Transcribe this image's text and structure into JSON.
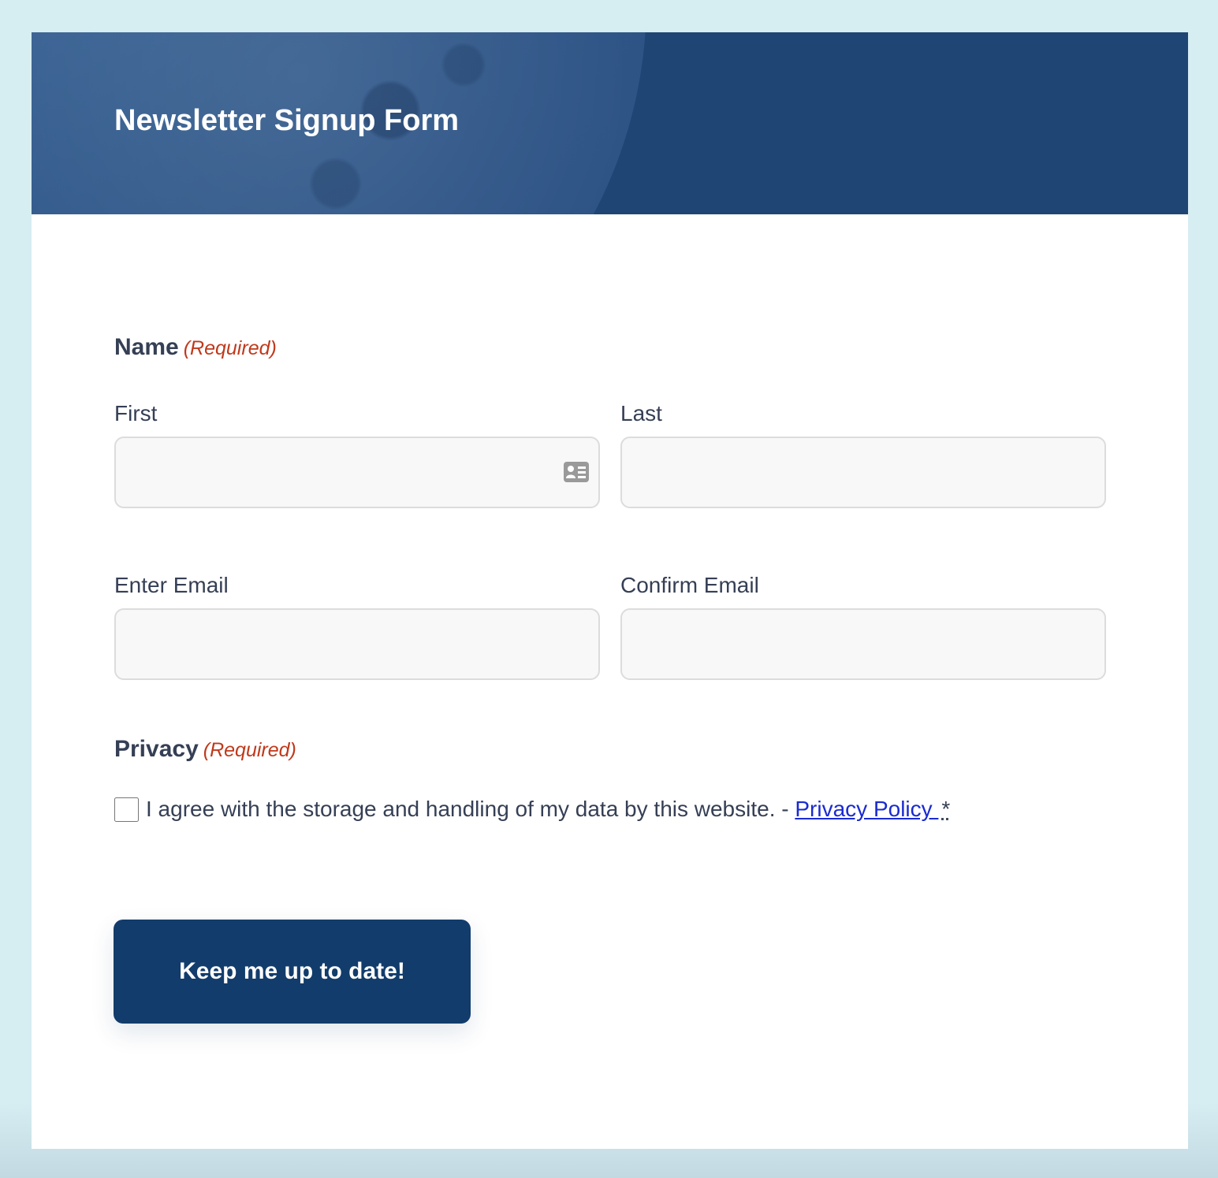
{
  "form": {
    "title": "Newsletter Signup Form"
  },
  "name_field": {
    "label": "Name",
    "required": "(Required)",
    "first_label": "First",
    "last_label": "Last",
    "first_value": "",
    "last_value": ""
  },
  "email_field": {
    "enter_label": "Enter Email",
    "confirm_label": "Confirm Email",
    "enter_value": "",
    "confirm_value": ""
  },
  "privacy_field": {
    "label": "Privacy",
    "required": "(Required)",
    "consent_text": "I agree with the storage and handling of my data by this website. - ",
    "policy_link": "Privacy Policy ",
    "asterisk": "*",
    "checked": false
  },
  "submit": {
    "label": "Keep me up to date!"
  },
  "icons": {
    "autofill": "contact-card-icon"
  },
  "colors": {
    "header_bg": "#1f4575",
    "page_bg": "#d6edf2",
    "button_bg": "#123c6b",
    "required_text": "#c0391b",
    "link": "#1a2bd1"
  }
}
